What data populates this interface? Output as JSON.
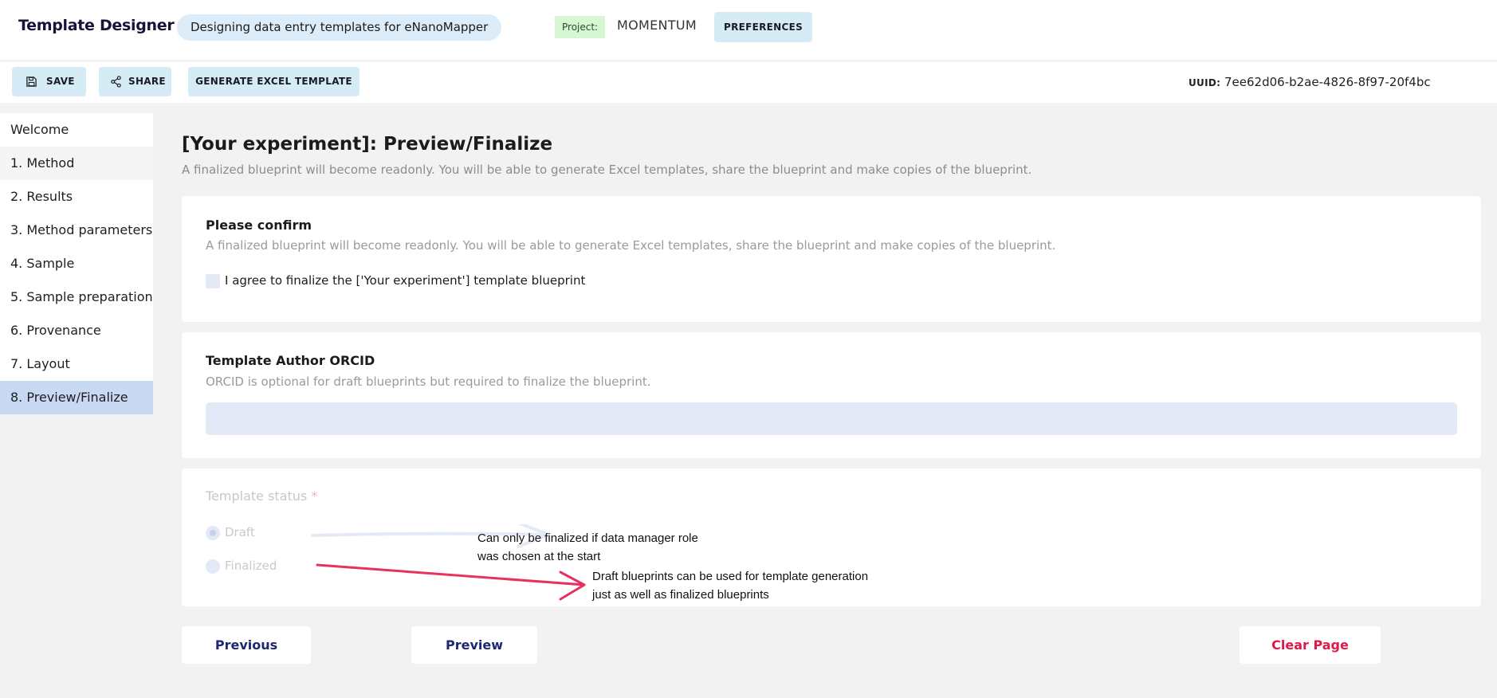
{
  "header": {
    "app_title": "Template Designer",
    "subtitle": "Designing data entry templates for eNanoMapper",
    "project_label": "Project:",
    "project_name": "MOMENTUM",
    "preferences_label": "PREFERENCES"
  },
  "toolbar": {
    "save_label": "SAVE",
    "save_icon": "floppy-disk-icon",
    "share_label": "SHARE",
    "share_icon": "share-icon",
    "generate_label": "GENERATE EXCEL TEMPLATE",
    "uuid_key": "UUID:",
    "uuid_value": "7ee62d06-b2ae-4826-8f97-20f4bc"
  },
  "sidebar": {
    "items": [
      {
        "label": "Welcome"
      },
      {
        "label": "1. Method"
      },
      {
        "label": "2. Results"
      },
      {
        "label": "3. Method parameters"
      },
      {
        "label": "4. Sample"
      },
      {
        "label": "5. Sample preparation"
      },
      {
        "label": "6. Provenance"
      },
      {
        "label": "7. Layout"
      },
      {
        "label": "8. Preview/Finalize"
      }
    ],
    "active_index": 8
  },
  "main": {
    "title": "[Your experiment]: Preview/Finalize",
    "description": "A finalized blueprint will become readonly. You will be able to generate Excel templates, share the blueprint and make copies of the blueprint.",
    "confirm": {
      "title": "Please confirm",
      "description": "A finalized blueprint will become readonly. You will be able to generate Excel templates, share the blueprint and make copies of the blueprint.",
      "checkbox_label": "I agree to finalize the ['Your experiment'] template blueprint",
      "checked": false
    },
    "orcid": {
      "title": "Template Author ORCID",
      "description": "ORCID is optional for draft blueprints but required to finalize the blueprint.",
      "value": ""
    },
    "status": {
      "title": "Template status",
      "required_mark": "*",
      "options": [
        {
          "label": "Draft",
          "selected": true
        },
        {
          "label": "Finalized",
          "selected": false
        }
      ]
    },
    "annotations": {
      "note1_line1": "Can only be finalized if data manager role",
      "note1_line2": "was chosen at the start",
      "note2_line1": "Draft blueprints can be used for template generation",
      "note2_line2": "just as well as finalized blueprints",
      "arrow1_color": "#e4e9f6",
      "arrow2_color": "#e8315f"
    }
  },
  "footer": {
    "previous_label": "Previous",
    "preview_label": "Preview",
    "clear_label": "Clear Page"
  },
  "colors": {
    "accent_light_blue": "#d5ecf7",
    "sidebar_active": "#c9d8f3",
    "danger": "#e0194a",
    "nav_text": "#1e2870"
  }
}
